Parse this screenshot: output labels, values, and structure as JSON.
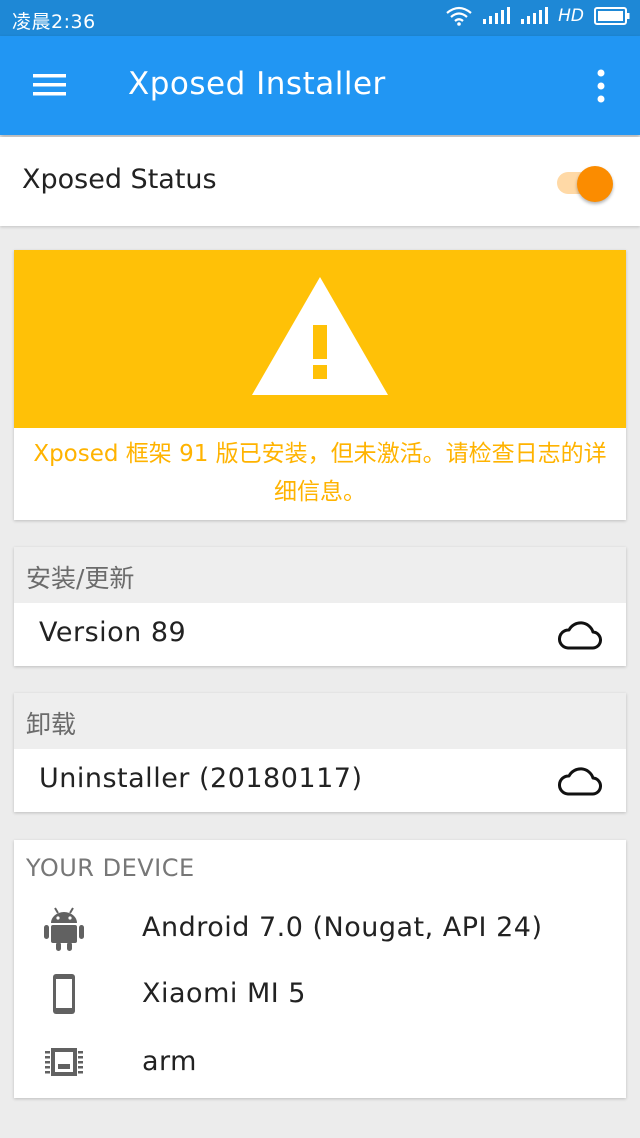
{
  "status_bar": {
    "time": "凌晨2:36",
    "network": "HD",
    "icons": [
      "wifi-icon",
      "signal-icon",
      "signal-icon",
      "battery-icon"
    ]
  },
  "app_bar": {
    "title": "Xposed Installer",
    "menu_icon": "hamburger-menu-icon",
    "overflow_icon": "more-vert-icon"
  },
  "xposed_status": {
    "label": "Xposed Status",
    "toggle_on": true
  },
  "warning": {
    "icon": "warning-icon",
    "message": "Xposed 框架 91 版已安装，但未激活。请检查日志的详细信息。"
  },
  "install_update": {
    "header": "安装/更新",
    "item": "Version 89",
    "icon": "cloud-download-icon"
  },
  "uninstall": {
    "header": "卸载",
    "item": "Uninstaller (20180117)",
    "icon": "cloud-download-icon"
  },
  "device": {
    "header": "YOUR DEVICE",
    "rows": [
      {
        "icon": "android-icon",
        "text": "Android 7.0 (Nougat, API 24)"
      },
      {
        "icon": "phone-icon",
        "text": "Xiaomi MI 5"
      },
      {
        "icon": "cpu-chip-icon",
        "text": "arm"
      }
    ]
  },
  "colors": {
    "app_bar": "#2196f3",
    "status_bar": "#1e88d6",
    "warning_banner": "#ffc107",
    "warning_text": "#ffb300",
    "toggle_accent": "#fb8c00"
  }
}
